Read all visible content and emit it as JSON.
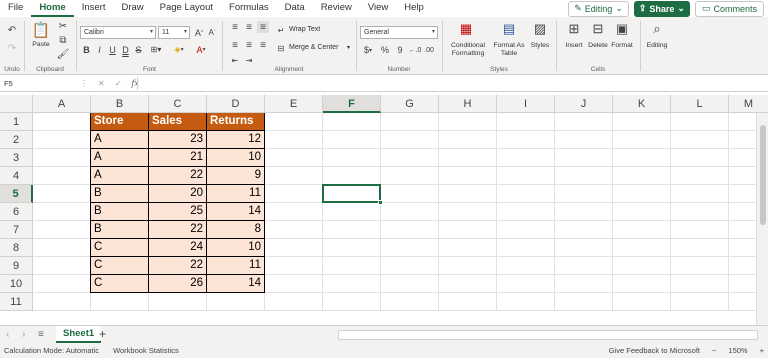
{
  "menu": {
    "tabs": [
      "File",
      "Home",
      "Insert",
      "Draw",
      "Page Layout",
      "Formulas",
      "Data",
      "Review",
      "View",
      "Help"
    ],
    "active": "Home",
    "editing_label": "Editing",
    "share_label": "Share",
    "comments_label": "Comments"
  },
  "ribbon": {
    "undo_label": "Undo",
    "paste_label": "Paste",
    "clipboard_label": "Clipboard",
    "font_name": "Calibri",
    "font_size": "11",
    "font_label": "Font",
    "wrap_text": "Wrap Text",
    "merge_center": "Merge & Center",
    "alignment_label": "Alignment",
    "number_format": "General",
    "number_label": "Number",
    "conditional_formatting": "Conditional Formatting",
    "format_as_table": "Format As Table",
    "styles_btn": "Styles",
    "styles_label": "Styles",
    "insert": "Insert",
    "delete": "Delete",
    "format": "Format",
    "cells_label": "Cells",
    "editing": "Editing",
    "currency_symbol": "$",
    "percent_symbol": "%",
    "comma_symbol": "9"
  },
  "formula_bar": {
    "name_box": "F5",
    "fx": "fx",
    "formula": ""
  },
  "grid": {
    "columns": [
      "A",
      "B",
      "C",
      "D",
      "E",
      "F",
      "G",
      "H",
      "I",
      "J",
      "K",
      "L",
      "M"
    ],
    "selected_column": "F",
    "rows": [
      "1",
      "2",
      "3",
      "4",
      "5",
      "6",
      "7",
      "8",
      "9",
      "10",
      "11"
    ],
    "selected_row": "5",
    "headers": [
      "Store",
      "Sales",
      "Returns"
    ],
    "data": [
      [
        "A",
        "23",
        "12"
      ],
      [
        "A",
        "21",
        "10"
      ],
      [
        "A",
        "22",
        "9"
      ],
      [
        "B",
        "20",
        "11"
      ],
      [
        "B",
        "25",
        "14"
      ],
      [
        "B",
        "22",
        "8"
      ],
      [
        "C",
        "24",
        "10"
      ],
      [
        "C",
        "22",
        "11"
      ],
      [
        "C",
        "26",
        "14"
      ]
    ]
  },
  "sheets": {
    "tabs": [
      "Sheet1"
    ],
    "add_label": "+"
  },
  "status": {
    "calc_mode": "Calculation Mode: Automatic",
    "workbook_stats": "Workbook Statistics",
    "feedback": "Give Feedback to Microsoft",
    "zoom": "150%"
  },
  "colors": {
    "accent": "#1e6c41",
    "header_fill": "#c55a11",
    "body_fill": "#fce4d6"
  }
}
